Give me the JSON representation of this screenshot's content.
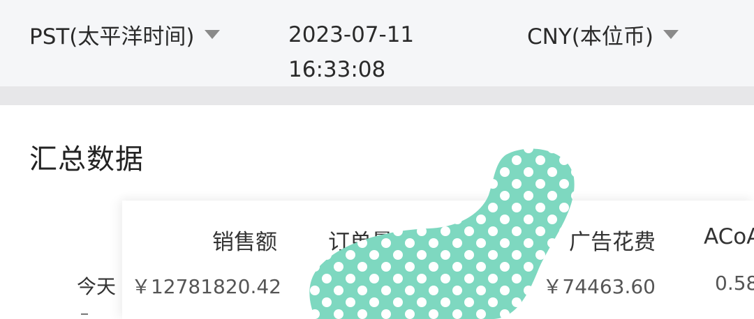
{
  "header": {
    "timezone_label": "PST(太平洋时间)",
    "date": "2023-07-11",
    "time": "16:33:08",
    "currency_label": "CNY(本位币)"
  },
  "summary": {
    "title": "汇总数据",
    "columns": [
      "销售额",
      "订单量",
      "广告花费",
      "ACoA"
    ],
    "rows": [
      {
        "label": "今天",
        "sales": "￥12781820.42",
        "ad_spend": "￥74463.60",
        "acoa": "0.58"
      }
    ]
  },
  "colors": {
    "blob": "#7ed8c0",
    "dots": "#ffffff"
  }
}
